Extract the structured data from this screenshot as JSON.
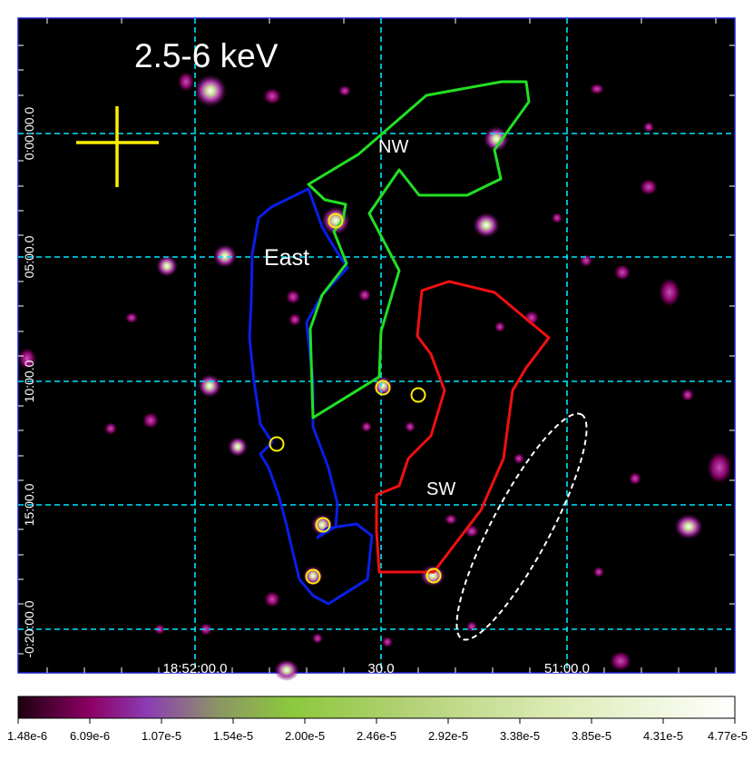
{
  "image": {
    "band_label": "2.5-6 keV",
    "region_labels": {
      "east": "East",
      "nw": "NW",
      "sw": "SW"
    },
    "ra_ticks": [
      "18:52:00.0",
      "30.0",
      "51:00.0"
    ],
    "dec_ticks": [
      "0:00:00.0",
      "05:00.0",
      "10:00.0",
      "15:00.0",
      "-0:20:00.0"
    ],
    "colorbar_ticks": [
      "1.48e-6",
      "6.09e-6",
      "1.07e-5",
      "1.54e-5",
      "2.00e-5",
      "2.46e-5",
      "2.92e-5",
      "3.38e-5",
      "3.85e-5",
      "4.31e-5",
      "4.77e-5"
    ],
    "colors": {
      "background": "#000000",
      "grid": "#00e5ff",
      "east_region": "#0a1ee6",
      "nw_region": "#22e022",
      "sw_region": "#f01010",
      "marker": "#ffee00",
      "background_region": "#ffffff",
      "frame": "#1a1ad0"
    }
  }
}
